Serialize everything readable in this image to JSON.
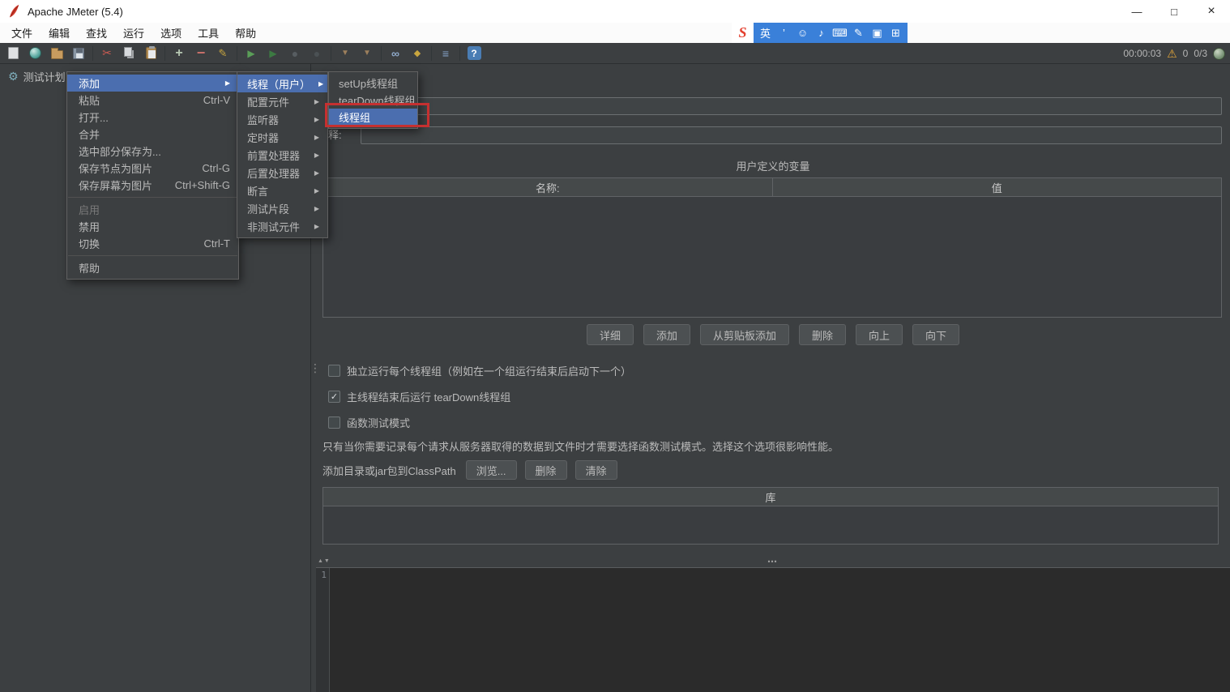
{
  "icons": {
    "submenu_arrow": "▶",
    "check": "✓",
    "warning": "⚠",
    "gear": "⚙",
    "splitter_dots": "⋮",
    "divider_handle": "⋯",
    "divider_arrows": "▲▼"
  },
  "window": {
    "title": "Apache JMeter (5.4)",
    "minimize": "—",
    "maximize": "□",
    "close": "×"
  },
  "menubar": {
    "items": [
      "文件",
      "编辑",
      "查找",
      "运行",
      "选项",
      "工具",
      "帮助"
    ]
  },
  "ime": {
    "logo": "S",
    "items": [
      {
        "name": "lang-indicator",
        "glyph": "英"
      },
      {
        "name": "apostrophe-icon",
        "glyph": "’"
      },
      {
        "name": "emoji-face-icon",
        "glyph": "☺"
      },
      {
        "name": "microphone-icon",
        "glyph": "♪"
      },
      {
        "name": "keyboard-icon",
        "glyph": "⌨"
      },
      {
        "name": "handwriting-icon",
        "glyph": "✎"
      },
      {
        "name": "skin-icon",
        "glyph": "▣"
      },
      {
        "name": "grid-icon",
        "glyph": "⊞"
      }
    ]
  },
  "toolbar": {
    "timer": "00:00:03",
    "warning_count": "0",
    "thread_counter": "0/3",
    "glyphs": {
      "cut": "✂",
      "plus": "+",
      "minus": "−",
      "edit": "✎",
      "play": "▶",
      "play_alt": "▶",
      "stop": "●",
      "shutdown": "●",
      "clear": "▼",
      "clear_all": "▼",
      "search": "∞",
      "search_reset": "◆",
      "function": "≡",
      "help": "?"
    }
  },
  "tree": {
    "root_label": "测试计划"
  },
  "context_menu": {
    "items": [
      {
        "label": "添加"
      },
      {
        "label": "粘贴",
        "shortcut": "Ctrl-V"
      },
      {
        "label": "打开..."
      },
      {
        "label": "合并"
      },
      {
        "label": "选中部分保存为..."
      },
      {
        "label": "保存节点为图片",
        "shortcut": "Ctrl-G"
      },
      {
        "label": "保存屏幕为图片",
        "shortcut": "Ctrl+Shift-G"
      },
      {
        "label": "启用"
      },
      {
        "label": "禁用"
      },
      {
        "label": "切换",
        "shortcut": "Ctrl-T"
      },
      {
        "label": "帮助"
      }
    ]
  },
  "add_submenu": {
    "items": [
      "线程（用户）",
      "配置元件",
      "监听器",
      "定时器",
      "前置处理器",
      "后置处理器",
      "断言",
      "测试片段",
      "非测试元件"
    ]
  },
  "threads_submenu": {
    "items": [
      "setUp线程组",
      "tearDown线程组",
      "线程组"
    ]
  },
  "editor": {
    "name_value": "",
    "comments_label": "注释:",
    "comments_value": "",
    "udv_title": "用户定义的变量",
    "udv_headers": [
      "名称:",
      "值"
    ],
    "action_buttons": [
      "详细",
      "添加",
      "从剪贴板添加",
      "删除",
      "向上",
      "向下"
    ],
    "checkbox_serial": "独立运行每个线程组（例如在一个组运行结束后启动下一个）",
    "checkbox_teardown": "主线程结束后运行 tearDown线程组",
    "checkbox_functional": "函数测试模式",
    "functional_note": "只有当你需要记录每个请求从服务器取得的数据到文件时才需要选择函数测试模式。选择这个选项很影响性能。",
    "classpath_label": "添加目录或jar包到ClassPath",
    "classpath_buttons": [
      "浏览...",
      "删除",
      "清除"
    ],
    "library_header": "库"
  },
  "log": {
    "first_line": "1"
  }
}
